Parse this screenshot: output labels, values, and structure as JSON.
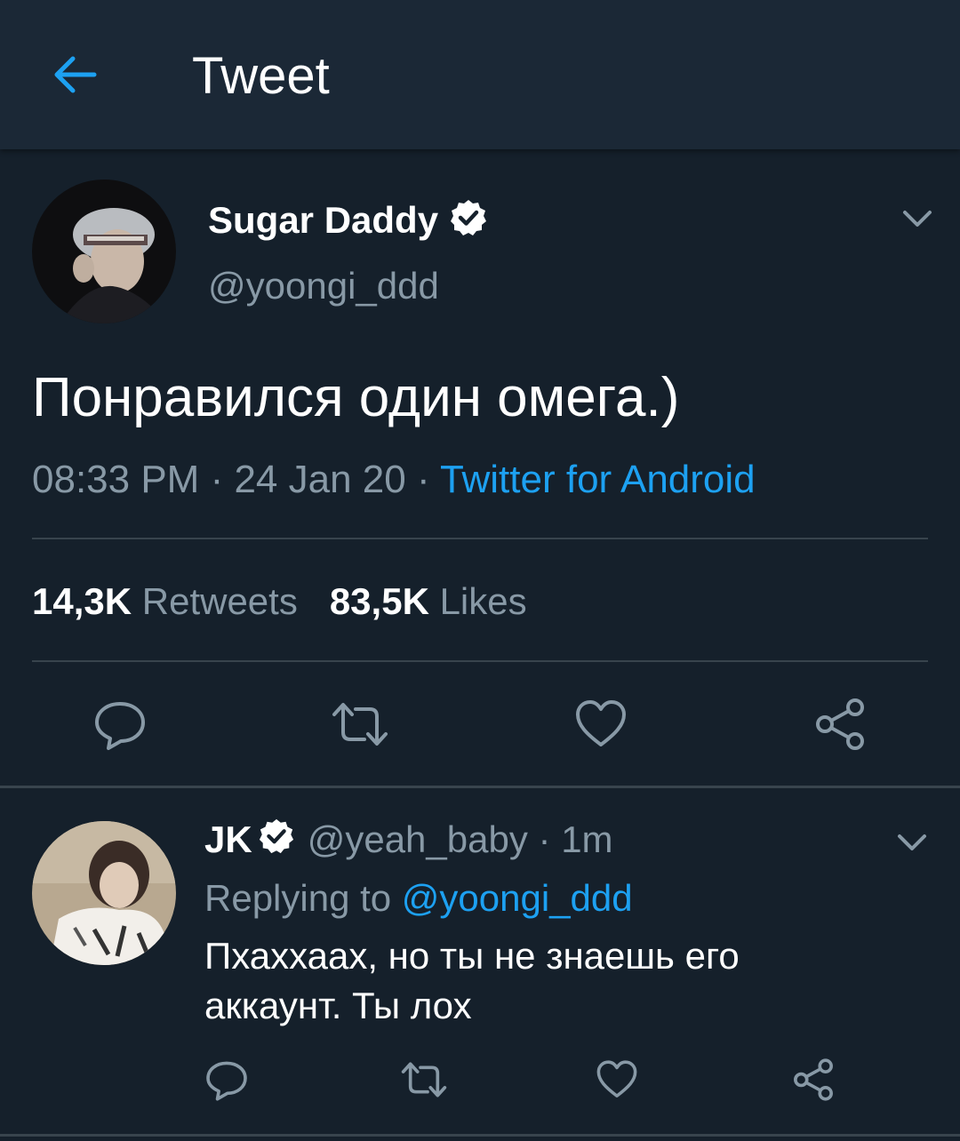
{
  "header": {
    "title": "Tweet",
    "back_icon": "arrow-left-icon",
    "accent": "#1da1f2"
  },
  "tweet": {
    "author": {
      "name": "Sugar Daddy",
      "handle": "@yoongi_ddd",
      "verified": true
    },
    "text": "Понравился один омега.)",
    "time": "08:33 PM",
    "date": "24 Jan 20",
    "separator": " · ",
    "source": "Twitter for Android",
    "stats": {
      "retweets_count": "14,3K",
      "retweets_label": "Retweets",
      "likes_count": "83,5K",
      "likes_label": "Likes"
    },
    "actions": [
      "reply-icon",
      "retweet-icon",
      "like-icon",
      "share-icon"
    ]
  },
  "reply": {
    "author": {
      "name": "JK",
      "handle": "@yeah_baby",
      "verified": true
    },
    "separator": " · ",
    "time_ago": "1m",
    "replying_label": "Replying to ",
    "replying_to": "@yoongi_ddd",
    "text_line1": "Пхаххаах, но ты не знаешь его",
    "text_line2": "аккаунт. Ты лох",
    "actions": [
      "reply-icon",
      "retweet-icon",
      "like-icon",
      "share-icon"
    ]
  },
  "colors": {
    "background": "#15202b",
    "header_background": "#1b2836",
    "secondary_text": "#8899a6",
    "link": "#1da1f2",
    "divider": "#38444d"
  }
}
